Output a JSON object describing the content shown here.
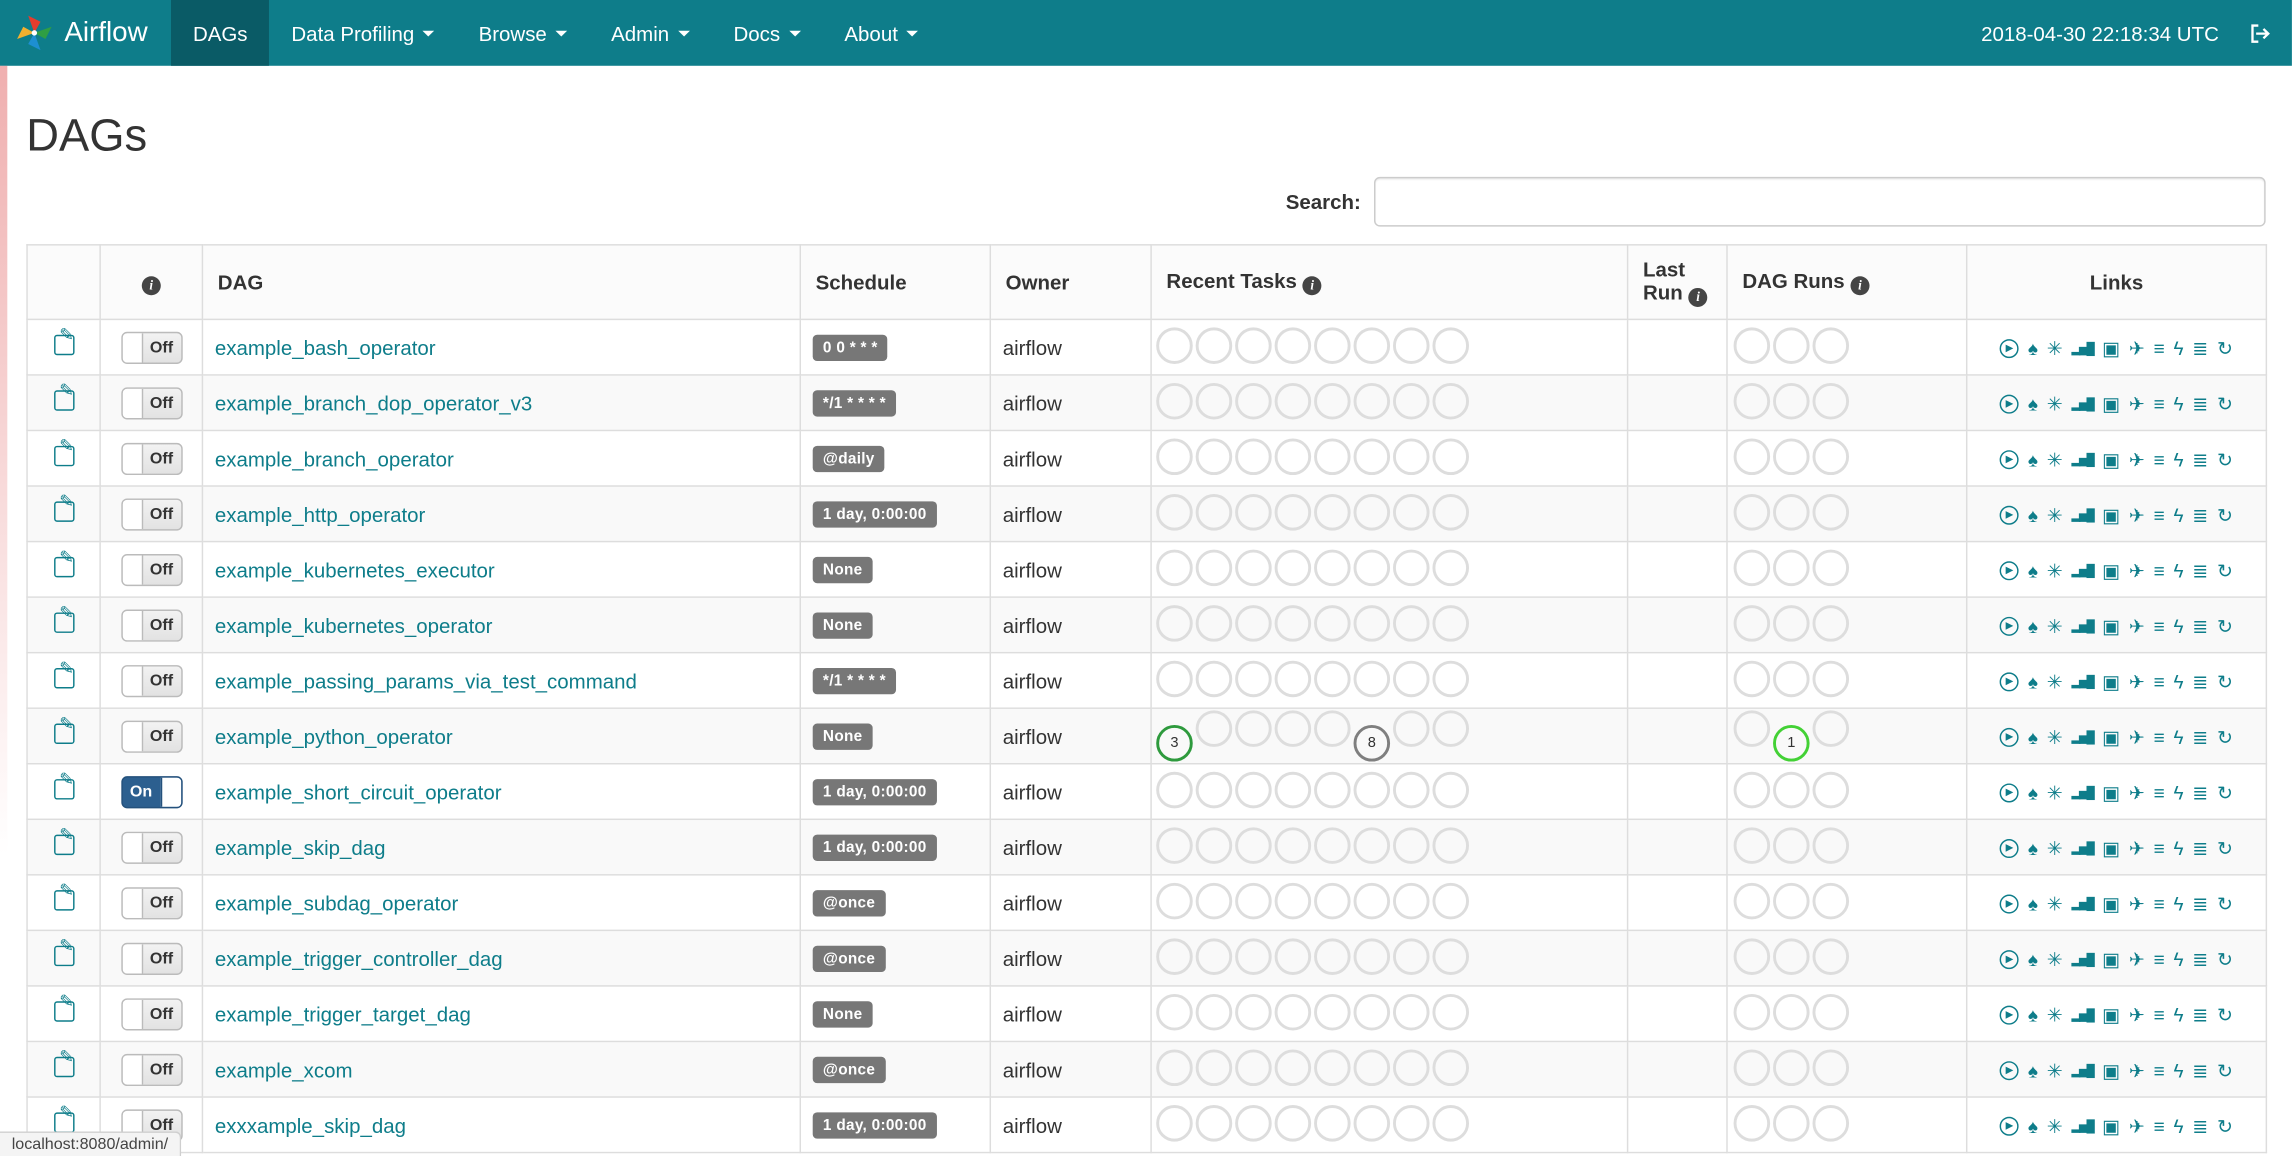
{
  "colors": {
    "navbar": "#0e7d8a",
    "navbar_active": "#0a5b66",
    "accent_link": "#0e7d8a",
    "schedule_badge": "#777777",
    "toggle_on": "#2c5f8f",
    "circle_border": "#dddddd",
    "task_success_green": "#2e9a3d",
    "task_gray": "#7f7f7f",
    "run_running_green": "#43d135"
  },
  "navbar": {
    "brand": "Airflow",
    "items": [
      {
        "id": "dags",
        "label": "DAGs",
        "active": true,
        "caret": false
      },
      {
        "id": "data-profiling",
        "label": "Data Profiling",
        "active": false,
        "caret": true
      },
      {
        "id": "browse",
        "label": "Browse",
        "active": false,
        "caret": true
      },
      {
        "id": "admin",
        "label": "Admin",
        "active": false,
        "caret": true
      },
      {
        "id": "docs",
        "label": "Docs",
        "active": false,
        "caret": true
      },
      {
        "id": "about",
        "label": "About",
        "active": false,
        "caret": true
      }
    ],
    "clock": "2018-04-30 22:18:34 UTC"
  },
  "page": {
    "title": "DAGs",
    "search_label": "Search:"
  },
  "icons": {
    "info": "i"
  },
  "table": {
    "headers": {
      "dag": "DAG",
      "schedule": "Schedule",
      "owner": "Owner",
      "recent_tasks": "Recent Tasks",
      "last_run": "Last Run",
      "dag_runs": "DAG Runs",
      "links": "Links"
    },
    "toggle": {
      "on": "On",
      "off": "Off"
    },
    "recent_task_slots": 8,
    "dag_run_slots": 3,
    "link_icons": [
      {
        "name": "trigger-dag-icon",
        "glyph": "▶",
        "variant": "circled"
      },
      {
        "name": "tree-view-icon",
        "glyph": "♠"
      },
      {
        "name": "graph-view-icon",
        "glyph": "✳"
      },
      {
        "name": "task-duration-icon",
        "glyph": "▂▅█",
        "variant": "bars"
      },
      {
        "name": "task-tries-icon",
        "glyph": "▣"
      },
      {
        "name": "landing-times-icon",
        "glyph": "✈"
      },
      {
        "name": "gantt-view-icon",
        "glyph": "≡"
      },
      {
        "name": "code-view-icon",
        "glyph": "ϟ"
      },
      {
        "name": "task-details-icon",
        "glyph": "≣"
      },
      {
        "name": "refresh-icon",
        "glyph": "↻"
      }
    ],
    "rows": [
      {
        "name": "example_bash_operator",
        "schedule": "0 0 * * *",
        "owner": "airflow",
        "enabled": false,
        "recent_tasks": [],
        "dag_runs": []
      },
      {
        "name": "example_branch_dop_operator_v3",
        "schedule": "*/1 * * * *",
        "owner": "airflow",
        "enabled": false,
        "recent_tasks": [],
        "dag_runs": []
      },
      {
        "name": "example_branch_operator",
        "schedule": "@daily",
        "owner": "airflow",
        "enabled": false,
        "recent_tasks": [],
        "dag_runs": []
      },
      {
        "name": "example_http_operator",
        "schedule": "1 day, 0:00:00",
        "owner": "airflow",
        "enabled": false,
        "recent_tasks": [],
        "dag_runs": []
      },
      {
        "name": "example_kubernetes_executor",
        "schedule": "None",
        "owner": "airflow",
        "enabled": false,
        "recent_tasks": [],
        "dag_runs": []
      },
      {
        "name": "example_kubernetes_operator",
        "schedule": "None",
        "owner": "airflow",
        "enabled": false,
        "recent_tasks": [],
        "dag_runs": []
      },
      {
        "name": "example_passing_params_via_test_command",
        "schedule": "*/1 * * * *",
        "owner": "airflow",
        "enabled": false,
        "recent_tasks": [],
        "dag_runs": []
      },
      {
        "name": "example_python_operator",
        "schedule": "None",
        "owner": "airflow",
        "enabled": false,
        "recent_tasks": [
          {
            "slot": 0,
            "count": "3",
            "color": "#2e9a3d"
          },
          {
            "slot": 5,
            "count": "8",
            "color": "#7f7f7f"
          }
        ],
        "dag_runs": [
          {
            "slot": 1,
            "count": "1",
            "color": "#43d135"
          }
        ]
      },
      {
        "name": "example_short_circuit_operator",
        "schedule": "1 day, 0:00:00",
        "owner": "airflow",
        "enabled": true,
        "recent_tasks": [],
        "dag_runs": []
      },
      {
        "name": "example_skip_dag",
        "schedule": "1 day, 0:00:00",
        "owner": "airflow",
        "enabled": false,
        "recent_tasks": [],
        "dag_runs": []
      },
      {
        "name": "example_subdag_operator",
        "schedule": "@once",
        "owner": "airflow",
        "enabled": false,
        "recent_tasks": [],
        "dag_runs": []
      },
      {
        "name": "example_trigger_controller_dag",
        "schedule": "@once",
        "owner": "airflow",
        "enabled": false,
        "recent_tasks": [],
        "dag_runs": []
      },
      {
        "name": "example_trigger_target_dag",
        "schedule": "None",
        "owner": "airflow",
        "enabled": false,
        "recent_tasks": [],
        "dag_runs": []
      },
      {
        "name": "example_xcom",
        "schedule": "@once",
        "owner": "airflow",
        "enabled": false,
        "recent_tasks": [],
        "dag_runs": []
      },
      {
        "name": "exxxample_skip_dag",
        "schedule": "1 day, 0:00:00",
        "owner": "airflow",
        "enabled": false,
        "recent_tasks": [],
        "dag_runs": []
      }
    ]
  },
  "statusbar": "localhost:8080/admin/"
}
